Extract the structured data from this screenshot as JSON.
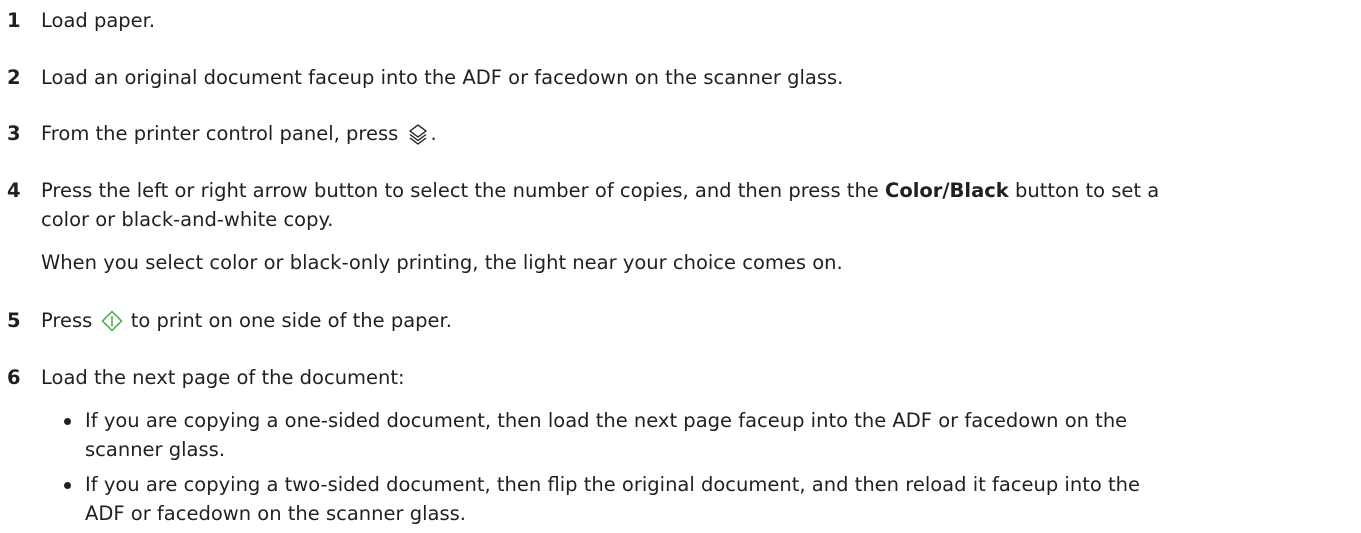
{
  "steps": [
    {
      "number": "1",
      "text": "Load paper."
    },
    {
      "number": "2",
      "text": "Load an original document faceup into the ADF or facedown on the scanner glass."
    },
    {
      "number": "3",
      "text_before": "From the printer control panel, press",
      "icon": "copy-stack-icon",
      "text_after": "."
    },
    {
      "number": "4",
      "text_before": "Press the left or right arrow button to select the number of copies, and then press the",
      "bold": "Color/Black",
      "text_after": "button to set a",
      "text_line2": "color or black-and-white copy.",
      "note": "When you select color or black-only printing, the light near your choice comes on."
    },
    {
      "number": "5",
      "text_before": "Press",
      "icon": "start-diamond-icon",
      "text_after": "to print on one side of the paper."
    },
    {
      "number": "6",
      "text": "Load the next page of the document:",
      "bullets": [
        {
          "line1": "If you are copying a one-sided document, then load the next page faceup into the ADF or facedown on the",
          "line2": "scanner glass."
        },
        {
          "line1": "If you are copying a two-sided document, then flip the original document, and then reload it faceup into the",
          "line2": "ADF or facedown on the scanner glass."
        }
      ]
    }
  ]
}
